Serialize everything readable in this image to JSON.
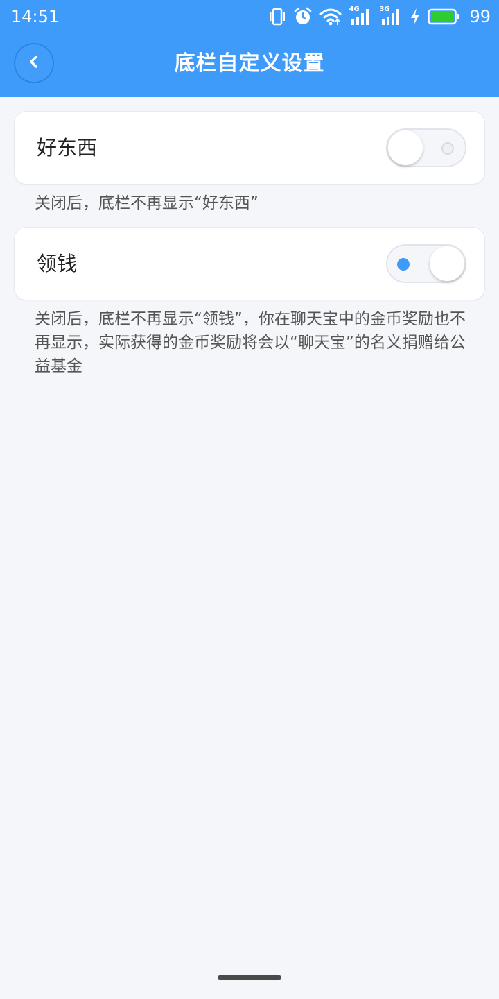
{
  "status_bar": {
    "time": "14:51",
    "network_labels": [
      "4G",
      "3G"
    ],
    "battery_percent": "99",
    "icons": [
      "vibrate-icon",
      "alarm-icon",
      "wifi-icon",
      "signal-4g-icon",
      "signal-3g-icon",
      "charging-icon",
      "battery-icon"
    ],
    "battery_color": "#2ecc2e"
  },
  "navbar": {
    "title": "底栏自定义设置",
    "back_icon": "chevron-left-icon",
    "background_color": "#3f9bfa"
  },
  "settings": [
    {
      "label": "好东西",
      "enabled": false,
      "description": "关闭后，底栏不再显示“好东西”"
    },
    {
      "label": "领钱",
      "enabled": true,
      "description": "关闭后，底栏不再显示“领钱”，你在聊天宝中的金币奖励也不再显示，实际获得的金币奖励将会以“聊天宝”的名义捐赠给公益基金"
    }
  ],
  "colors": {
    "accent": "#3f9bfa",
    "page_background": "#f5f6fa"
  }
}
